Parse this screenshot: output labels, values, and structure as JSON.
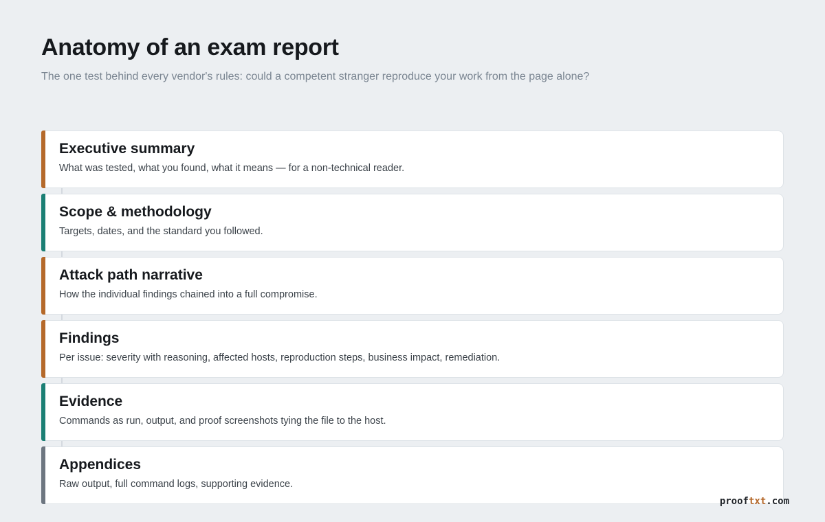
{
  "title": "Anatomy of an exam report",
  "subtitle": "The one test behind every vendor's rules: could a competent stranger reproduce your work from the page alone?",
  "sections": [
    {
      "title": "Executive summary",
      "description": "What was tested, what you found, what it means — for a non-technical reader.",
      "accent": "#b5692a"
    },
    {
      "title": "Scope & methodology",
      "description": "Targets, dates, and the standard you followed.",
      "accent": "#1b7f74"
    },
    {
      "title": "Attack path narrative",
      "description": "How the individual findings chained into a full compromise.",
      "accent": "#b5692a"
    },
    {
      "title": "Findings",
      "description": "Per issue: severity with reasoning, affected hosts, reproduction steps, business impact, remediation.",
      "accent": "#b5692a"
    },
    {
      "title": "Evidence",
      "description": "Commands as run, output, and proof screenshots tying the file to the host.",
      "accent": "#1b7f74"
    },
    {
      "title": "Appendices",
      "description": "Raw output, full command logs, supporting evidence.",
      "accent": "#6d7680"
    }
  ],
  "footer": {
    "brand_part1": "proof",
    "brand_part2": "txt",
    "brand_part3": ".com",
    "brand_accent_color": "#b5682a"
  }
}
